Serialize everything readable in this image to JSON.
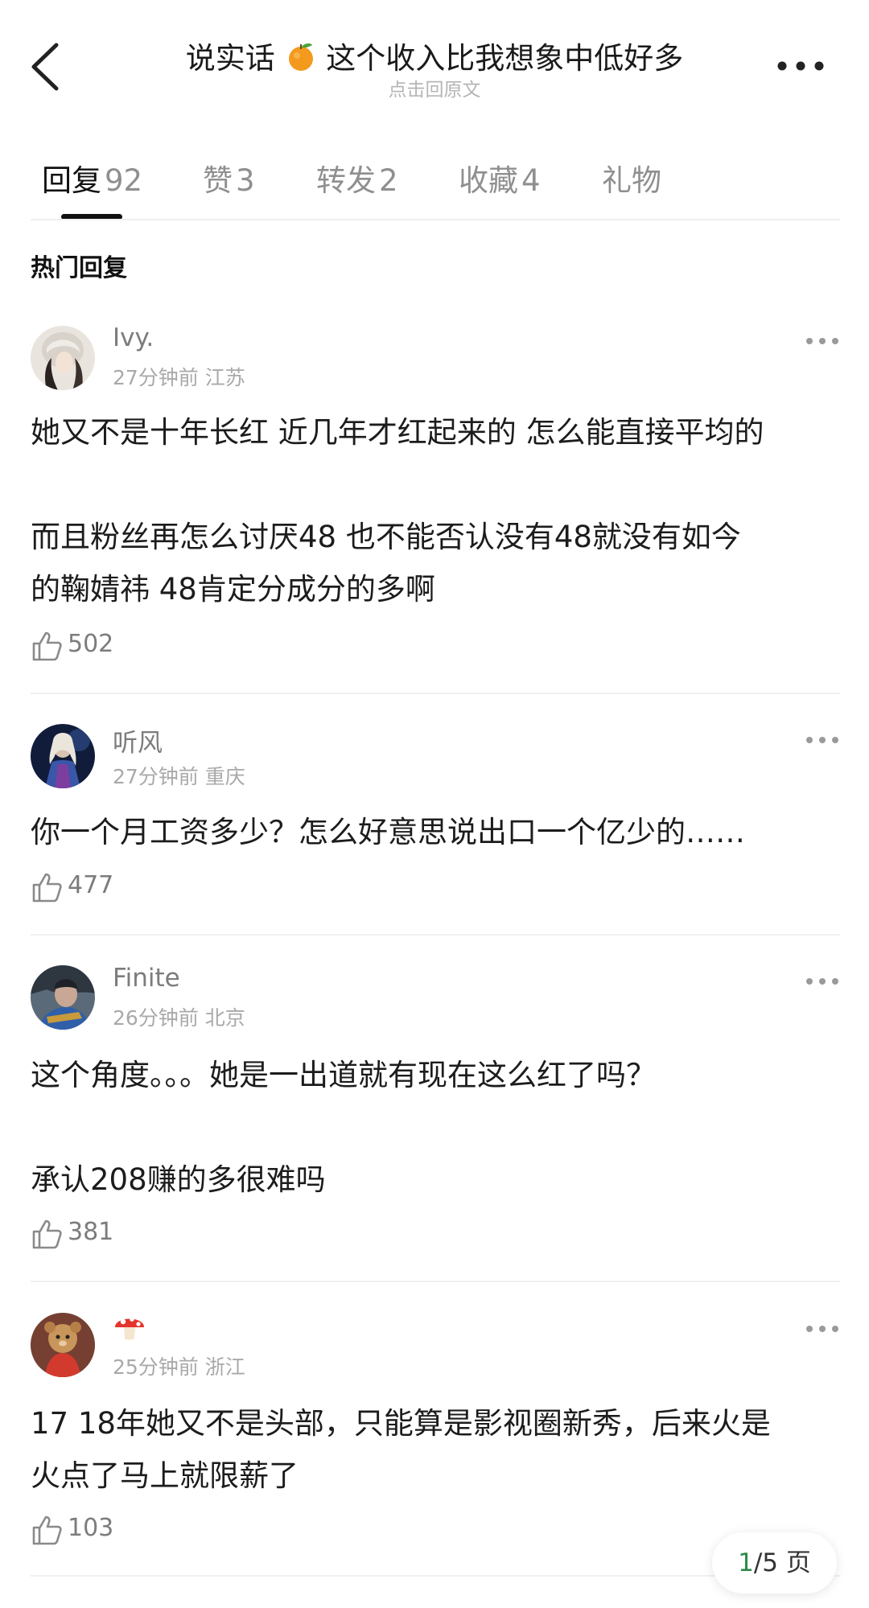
{
  "header": {
    "title_before": "说实话",
    "title_after": "这个收入比我想象中低好多",
    "subtitle": "点击回原文"
  },
  "tabs": [
    {
      "label": "回复",
      "count": "92"
    },
    {
      "label": "赞",
      "count": "3"
    },
    {
      "label": "转发",
      "count": "2"
    },
    {
      "label": "收藏",
      "count": "4"
    },
    {
      "label": "礼物",
      "count": ""
    }
  ],
  "section_title": "热门回复",
  "comments": [
    {
      "username": "Ivy.",
      "meta": "27分钟前 江苏",
      "lines": [
        "她又不是十年长红 近几年才红起来的  怎么能直接平均的",
        "",
        "而且粉丝再怎么讨厌48  也不能否认没有48就没有如今",
        "的鞠婧祎   48肯定分成分的多啊"
      ],
      "likes": "502"
    },
    {
      "username": "听风",
      "meta": "27分钟前 重庆",
      "lines": [
        "你一个月工资多少？怎么好意思说出口一个亿少的……"
      ],
      "likes": "477"
    },
    {
      "username": "Finite",
      "meta": "26分钟前 北京",
      "lines": [
        "这个角度。。。她是一出道就有现在这么红了吗？",
        "",
        "承认208赚的多很难吗"
      ],
      "likes": "381"
    },
    {
      "username": "🍄",
      "meta": "25分钟前 浙江",
      "lines": [
        "17 18年她又不是头部，只能算是影视圈新秀，后来火是",
        "火点了马上就限薪了"
      ],
      "likes": "103"
    }
  ],
  "pager": {
    "current": "1",
    "total": "/5 页"
  }
}
